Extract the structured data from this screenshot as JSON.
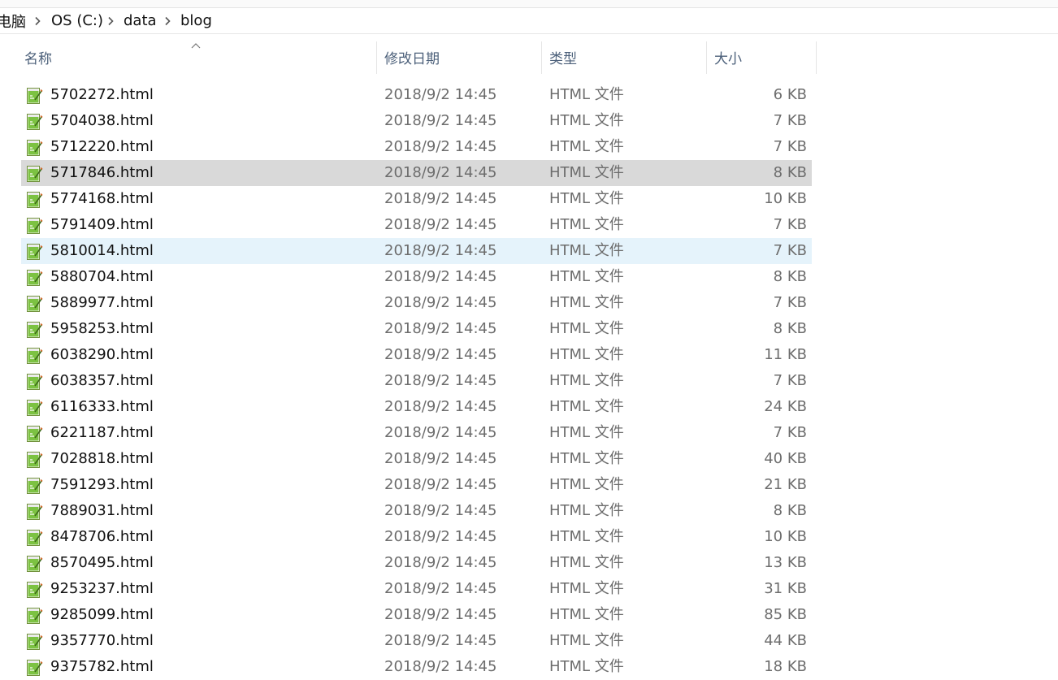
{
  "breadcrumb": {
    "items": [
      "电脑",
      "OS (C:)",
      "data",
      "blog"
    ]
  },
  "columns": {
    "name": "名称",
    "date": "修改日期",
    "type": "类型",
    "size": "大小"
  },
  "files": [
    {
      "name": "5702272.html",
      "date": "2018/9/2 14:45",
      "type": "HTML 文件",
      "size": "6 KB"
    },
    {
      "name": "5704038.html",
      "date": "2018/9/2 14:45",
      "type": "HTML 文件",
      "size": "7 KB"
    },
    {
      "name": "5712220.html",
      "date": "2018/9/2 14:45",
      "type": "HTML 文件",
      "size": "7 KB"
    },
    {
      "name": "5717846.html",
      "date": "2018/9/2 14:45",
      "type": "HTML 文件",
      "size": "8 KB",
      "state": "selected"
    },
    {
      "name": "5774168.html",
      "date": "2018/9/2 14:45",
      "type": "HTML 文件",
      "size": "10 KB"
    },
    {
      "name": "5791409.html",
      "date": "2018/9/2 14:45",
      "type": "HTML 文件",
      "size": "7 KB"
    },
    {
      "name": "5810014.html",
      "date": "2018/9/2 14:45",
      "type": "HTML 文件",
      "size": "7 KB",
      "state": "hover"
    },
    {
      "name": "5880704.html",
      "date": "2018/9/2 14:45",
      "type": "HTML 文件",
      "size": "8 KB"
    },
    {
      "name": "5889977.html",
      "date": "2018/9/2 14:45",
      "type": "HTML 文件",
      "size": "7 KB"
    },
    {
      "name": "5958253.html",
      "date": "2018/9/2 14:45",
      "type": "HTML 文件",
      "size": "8 KB"
    },
    {
      "name": "6038290.html",
      "date": "2018/9/2 14:45",
      "type": "HTML 文件",
      "size": "11 KB"
    },
    {
      "name": "6038357.html",
      "date": "2018/9/2 14:45",
      "type": "HTML 文件",
      "size": "7 KB"
    },
    {
      "name": "6116333.html",
      "date": "2018/9/2 14:45",
      "type": "HTML 文件",
      "size": "24 KB"
    },
    {
      "name": "6221187.html",
      "date": "2018/9/2 14:45",
      "type": "HTML 文件",
      "size": "7 KB"
    },
    {
      "name": "7028818.html",
      "date": "2018/9/2 14:45",
      "type": "HTML 文件",
      "size": "40 KB"
    },
    {
      "name": "7591293.html",
      "date": "2018/9/2 14:45",
      "type": "HTML 文件",
      "size": "21 KB"
    },
    {
      "name": "7889031.html",
      "date": "2018/9/2 14:45",
      "type": "HTML 文件",
      "size": "8 KB"
    },
    {
      "name": "8478706.html",
      "date": "2018/9/2 14:45",
      "type": "HTML 文件",
      "size": "10 KB"
    },
    {
      "name": "8570495.html",
      "date": "2018/9/2 14:45",
      "type": "HTML 文件",
      "size": "13 KB"
    },
    {
      "name": "9253237.html",
      "date": "2018/9/2 14:45",
      "type": "HTML 文件",
      "size": "31 KB"
    },
    {
      "name": "9285099.html",
      "date": "2018/9/2 14:45",
      "type": "HTML 文件",
      "size": "85 KB"
    },
    {
      "name": "9357770.html",
      "date": "2018/9/2 14:45",
      "type": "HTML 文件",
      "size": "44 KB"
    },
    {
      "name": "9375782.html",
      "date": "2018/9/2 14:45",
      "type": "HTML 文件",
      "size": "18 KB"
    }
  ],
  "icons": {
    "file": "html-file-icon",
    "separator": "chevron-right-icon",
    "sort": "sort-up-icon"
  },
  "colors": {
    "selected_row": "#d9d9d9",
    "hover_row": "#e5f3fb",
    "header_text": "#4c607a",
    "secondary_text": "#6d6d6d"
  }
}
